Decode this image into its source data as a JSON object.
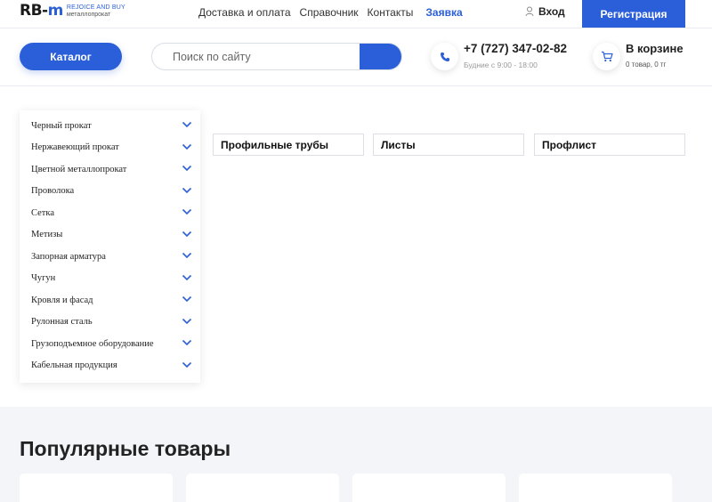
{
  "brand": {
    "logo_text_1": "RB-",
    "logo_text_2": "m",
    "tagline_1": "REJOICE AND BUY",
    "tagline_2": "металлопрокат"
  },
  "topnav": {
    "items": [
      "Доставка и оплата",
      "Справочник",
      "Контакты"
    ],
    "accent_item": "Заявка",
    "login": "Вход",
    "register": "Регистрация"
  },
  "header": {
    "catalog_button": "Каталог",
    "search_placeholder": "Поиск по сайту",
    "phone": "+7 (727) 347-02-82",
    "hours": "Будние с 9:00 - 18:00",
    "cart_title": "В корзине",
    "cart_summary": "0 товар, 0 тг"
  },
  "sidebar": {
    "items": [
      "Черный прокат",
      "Нержавеющий прокат",
      "Цветной металлопрокат",
      "Проволока",
      "Сетка",
      "Метизы",
      "Запорная арматура",
      "Чугун",
      "Кровля и фасад",
      "Рулонная сталь",
      "Грузоподъемное оборудование",
      "Кабельная продукция"
    ]
  },
  "categories": [
    "Профильные трубы",
    "Листы",
    "Профлист"
  ],
  "popular": {
    "title": "Популярные товары"
  },
  "colors": {
    "accent": "#2b5fd9",
    "section_bg": "#f4f5f8"
  }
}
